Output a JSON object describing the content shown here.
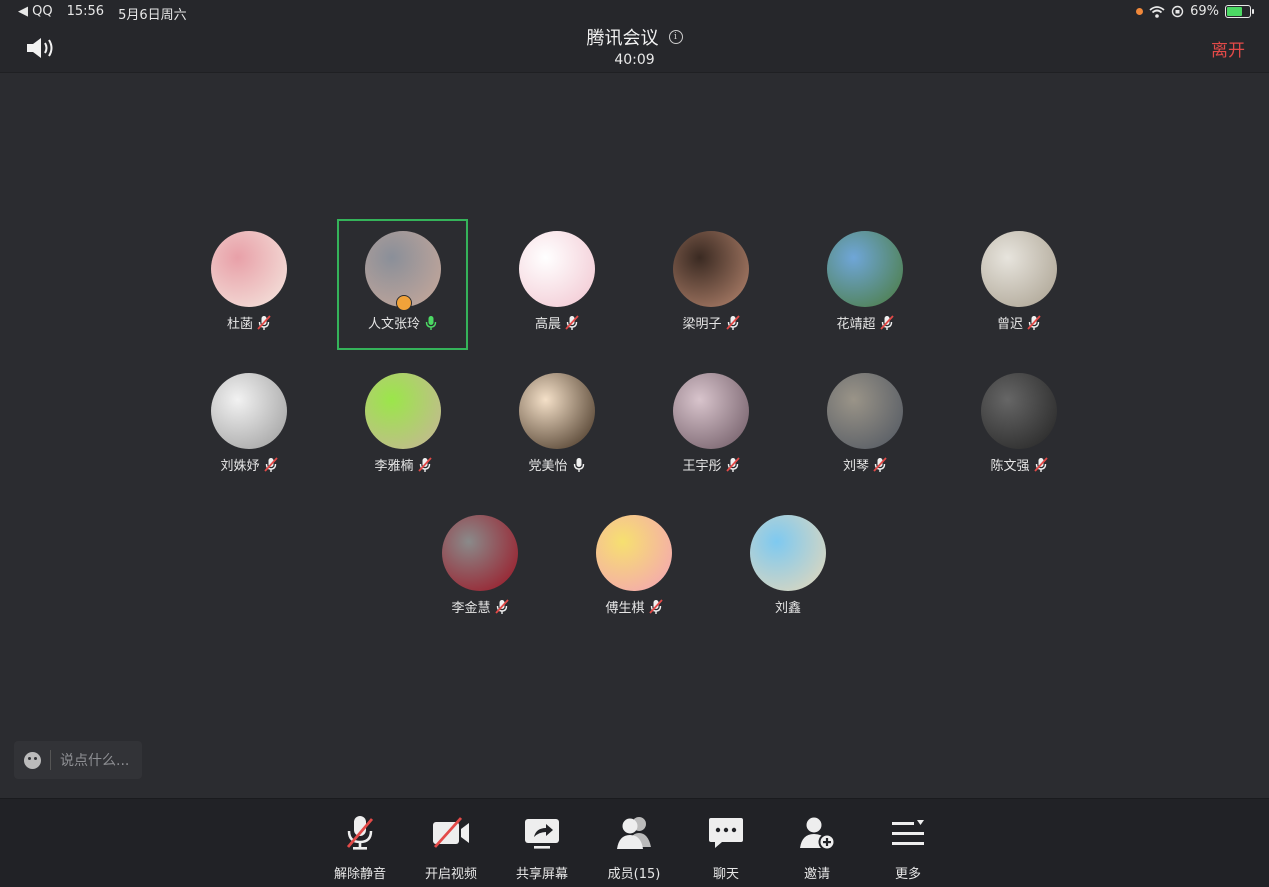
{
  "status_bar": {
    "back_app": "◀ QQ",
    "time": "15:56",
    "date": "5月6日周六",
    "battery": "69%"
  },
  "header": {
    "title": "腾讯会议",
    "timer": "40:09",
    "leave": "离开"
  },
  "participants": [
    {
      "name": "杜菡",
      "mic": "muted",
      "colors": [
        "#e8a0a8",
        "#f5e8e0"
      ]
    },
    {
      "name": "人文张玲",
      "mic": "on",
      "colors": [
        "#8a8f99",
        "#c9a99a"
      ]
    },
    {
      "name": "高晨",
      "mic": "muted",
      "colors": [
        "#ffffff",
        "#f1c4cf"
      ]
    },
    {
      "name": "梁明子",
      "mic": "muted",
      "colors": [
        "#3a2a22",
        "#b88770"
      ]
    },
    {
      "name": "花靖超",
      "mic": "muted",
      "colors": [
        "#6fa6d8",
        "#4a7a3a"
      ]
    },
    {
      "name": "曾迟",
      "mic": "muted",
      "colors": [
        "#e7e4dd",
        "#a89f8e"
      ]
    },
    {
      "name": "刘姝妤",
      "mic": "muted",
      "colors": [
        "#f2f2f2",
        "#9a9a9a"
      ]
    },
    {
      "name": "李雅楠",
      "mic": "muted",
      "colors": [
        "#9be64a",
        "#c9b39a"
      ]
    },
    {
      "name": "党美怡",
      "mic": "on-white",
      "colors": [
        "#f4e0c8",
        "#3b2a1a"
      ]
    },
    {
      "name": "王宇彤",
      "mic": "muted",
      "colors": [
        "#d8c4cc",
        "#6a5560"
      ]
    },
    {
      "name": "刘琴",
      "mic": "muted",
      "colors": [
        "#9a9488",
        "#4e5560"
      ]
    },
    {
      "name": "陈文强",
      "mic": "muted",
      "colors": [
        "#666",
        "#222"
      ]
    },
    {
      "name": "李金慧",
      "mic": "muted",
      "colors": [
        "#8a8a8a",
        "#9c1020"
      ]
    },
    {
      "name": "傅生棋",
      "mic": "muted",
      "colors": [
        "#f6e070",
        "#f4a0b8"
      ]
    },
    {
      "name": "刘鑫",
      "mic": "none",
      "colors": [
        "#7ec9f0",
        "#e8d8b8"
      ]
    }
  ],
  "chat": {
    "placeholder": "说点什么..."
  },
  "toolbar": {
    "items": [
      {
        "label": "解除静音",
        "icon": "mic-muted-icon"
      },
      {
        "label": "开启视频",
        "icon": "video-off-icon"
      },
      {
        "label": "共享屏幕",
        "icon": "share-screen-icon"
      },
      {
        "label": "成员(15)",
        "icon": "members-icon"
      },
      {
        "label": "聊天",
        "icon": "chat-icon"
      },
      {
        "label": "邀请",
        "icon": "invite-icon"
      },
      {
        "label": "更多",
        "icon": "more-icon"
      }
    ]
  },
  "colors": {
    "accent_green": "#35b35a",
    "leave_red": "#e34a48",
    "mute_red": "#e34a48"
  }
}
